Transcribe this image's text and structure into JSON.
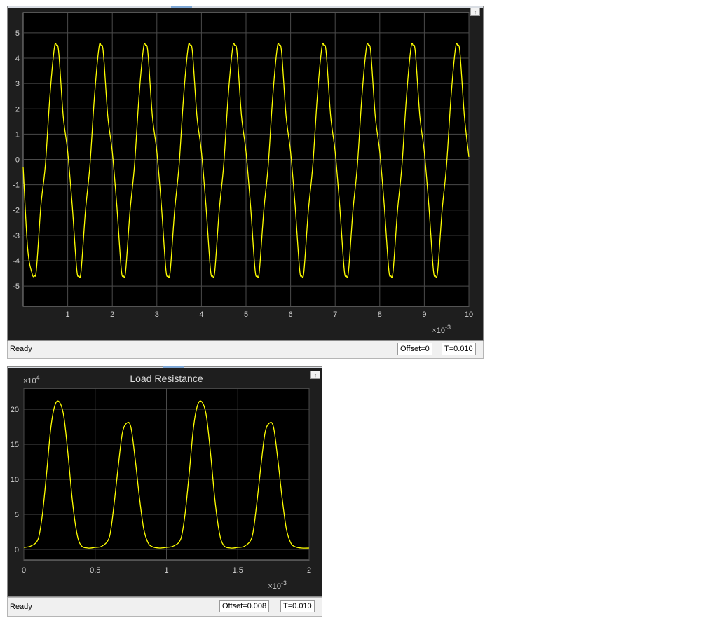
{
  "scopes": [
    {
      "status": {
        "ready": "Ready",
        "offset": "Offset=0",
        "time": "T=0.010"
      },
      "chart_data": {
        "type": "line",
        "title": "",
        "xlabel": "",
        "ylabel": "",
        "x_multiplier": "×10",
        "x_multiplier_exponent": "-3",
        "y_multiplier": "",
        "y_multiplier_exponent": "",
        "xlim": [
          0,
          10
        ],
        "ylim": [
          -5.8,
          5.8
        ],
        "xticks": [
          "1",
          "2",
          "3",
          "4",
          "5",
          "6",
          "7",
          "8",
          "9",
          "10"
        ],
        "xtick_values": [
          1,
          2,
          3,
          4,
          5,
          6,
          7,
          8,
          9,
          10
        ],
        "yticks": [
          "5",
          "4",
          "3",
          "2",
          "1",
          "0",
          "-1",
          "-2",
          "-3",
          "-4",
          "-5"
        ],
        "ytick_values": [
          5,
          4,
          3,
          2,
          1,
          0,
          -1,
          -2,
          -3,
          -4,
          -5
        ],
        "grid": true,
        "line_color": "#ffff00",
        "series": [
          {
            "x": [
              0.0,
              0.1,
              0.2,
              0.25,
              0.3,
              0.4,
              0.5,
              0.6,
              0.7,
              0.75,
              0.8,
              0.9,
              1.0,
              1.1,
              1.2,
              1.25,
              1.3,
              1.4,
              1.5,
              1.6,
              1.7,
              1.75,
              1.8,
              1.9,
              2.0,
              2.1,
              2.2,
              2.25,
              2.3,
              2.4,
              2.5,
              2.6,
              2.7,
              2.75,
              2.8,
              2.9,
              3.0,
              3.1,
              3.2,
              3.25,
              3.3,
              3.4,
              3.5,
              3.6,
              3.7,
              3.75,
              3.8,
              3.9,
              4.0,
              4.1,
              4.2,
              4.25,
              4.3,
              4.4,
              4.5,
              4.6,
              4.7,
              4.75,
              4.8,
              4.9,
              5.0,
              5.1,
              5.2,
              5.25,
              5.3,
              5.4,
              5.5,
              5.6,
              5.7,
              5.75,
              5.8,
              5.9,
              6.0,
              6.1,
              6.2,
              6.25,
              6.3,
              6.4,
              6.5,
              6.6,
              6.7,
              6.75,
              6.8,
              6.9,
              7.0,
              7.1,
              7.2,
              7.25,
              7.3,
              7.4,
              7.5,
              7.6,
              7.7,
              7.75,
              7.8,
              7.9,
              8.0,
              8.1,
              8.2,
              8.25,
              8.3,
              8.4,
              8.5,
              8.6,
              8.7,
              8.75,
              8.8,
              8.9,
              9.0,
              9.1,
              9.2,
              9.25,
              9.3,
              9.4,
              9.5,
              9.6,
              9.7,
              9.75,
              9.8,
              9.9,
              10.0
            ],
            "y": [
              -0.3,
              -3.5,
              -4.5,
              -4.6,
              -4.3,
              -1.8,
              -0.2,
              2.5,
              4.4,
              4.5,
              4.2,
              1.7,
              0.3,
              -1.8,
              -4.3,
              -4.6,
              -4.4,
              -2.0,
              -0.2,
              2.5,
              4.4,
              4.5,
              4.2,
              1.7,
              0.3,
              -1.8,
              -4.3,
              -4.6,
              -4.4,
              -2.0,
              -0.2,
              2.5,
              4.4,
              4.5,
              4.2,
              1.7,
              0.3,
              -1.8,
              -4.3,
              -4.6,
              -4.4,
              -2.0,
              -0.2,
              2.5,
              4.4,
              4.5,
              4.2,
              1.7,
              0.3,
              -1.8,
              -4.3,
              -4.6,
              -4.4,
              -2.0,
              -0.2,
              2.5,
              4.4,
              4.5,
              4.2,
              1.7,
              0.3,
              -1.8,
              -4.3,
              -4.6,
              -4.4,
              -2.0,
              -0.2,
              2.5,
              4.4,
              4.5,
              4.2,
              1.7,
              0.3,
              -1.8,
              -4.3,
              -4.6,
              -4.4,
              -2.0,
              -0.2,
              2.5,
              4.4,
              4.5,
              4.2,
              1.7,
              0.3,
              -1.8,
              -4.3,
              -4.6,
              -4.4,
              -2.0,
              -0.2,
              2.5,
              4.4,
              4.5,
              4.2,
              1.7,
              0.3,
              -1.8,
              -4.3,
              -4.6,
              -4.4,
              -2.0,
              -0.2,
              2.5,
              4.4,
              4.5,
              4.2,
              1.7,
              0.3,
              -1.8,
              -4.3,
              -4.6,
              -4.4,
              -2.0,
              -0.2,
              2.5,
              4.4,
              4.5,
              4.2,
              1.7,
              0.1
            ]
          }
        ]
      }
    },
    {
      "status": {
        "ready": "Ready",
        "offset": "Offset=0.008",
        "time": "T=0.010"
      },
      "chart_data": {
        "type": "line",
        "title": "Load Resistance",
        "xlabel": "",
        "ylabel": "",
        "x_multiplier": "×10",
        "x_multiplier_exponent": "-3",
        "y_multiplier": "×10",
        "y_multiplier_exponent": "4",
        "xlim": [
          0,
          2
        ],
        "ylim": [
          -1.5,
          23
        ],
        "xticks": [
          "0",
          "0.5",
          "1",
          "1.5",
          "2"
        ],
        "xtick_values": [
          0,
          0.5,
          1,
          1.5,
          2
        ],
        "yticks": [
          "20",
          "15",
          "10",
          "5",
          "0"
        ],
        "ytick_values": [
          20,
          15,
          10,
          5,
          0
        ],
        "grid": true,
        "line_color": "#ffff00",
        "series": [
          {
            "x": [
              0.0,
              0.05,
              0.1,
              0.13,
              0.16,
              0.19,
              0.22,
              0.25,
              0.28,
              0.31,
              0.34,
              0.37,
              0.4,
              0.45,
              0.5,
              0.55,
              0.6,
              0.63,
              0.66,
              0.69,
              0.72,
              0.75,
              0.78,
              0.81,
              0.84,
              0.87,
              0.9,
              0.95,
              1.0,
              1.05,
              1.1,
              1.13,
              1.16,
              1.19,
              1.22,
              1.25,
              1.28,
              1.31,
              1.34,
              1.37,
              1.4,
              1.45,
              1.5,
              1.55,
              1.6,
              1.63,
              1.66,
              1.69,
              1.72,
              1.75,
              1.78,
              1.81,
              1.84,
              1.87,
              1.9,
              1.95,
              2.0
            ],
            "y": [
              0.3,
              0.5,
              1.5,
              5.0,
              11.0,
              17.5,
              20.7,
              21.0,
              19.0,
              13.5,
              7.0,
              2.5,
              0.6,
              0.2,
              0.3,
              0.5,
              1.8,
              6.0,
              11.5,
              16.5,
              18.0,
              17.5,
              13.0,
              7.5,
              3.0,
              1.0,
              0.4,
              0.2,
              0.3,
              0.5,
              1.5,
              5.0,
              11.0,
              17.5,
              20.7,
              21.0,
              19.0,
              13.5,
              7.0,
              2.5,
              0.6,
              0.2,
              0.3,
              0.5,
              1.8,
              6.0,
              11.5,
              16.5,
              18.0,
              17.5,
              13.0,
              7.5,
              3.0,
              1.0,
              0.4,
              0.2,
              0.2
            ]
          }
        ]
      }
    }
  ]
}
